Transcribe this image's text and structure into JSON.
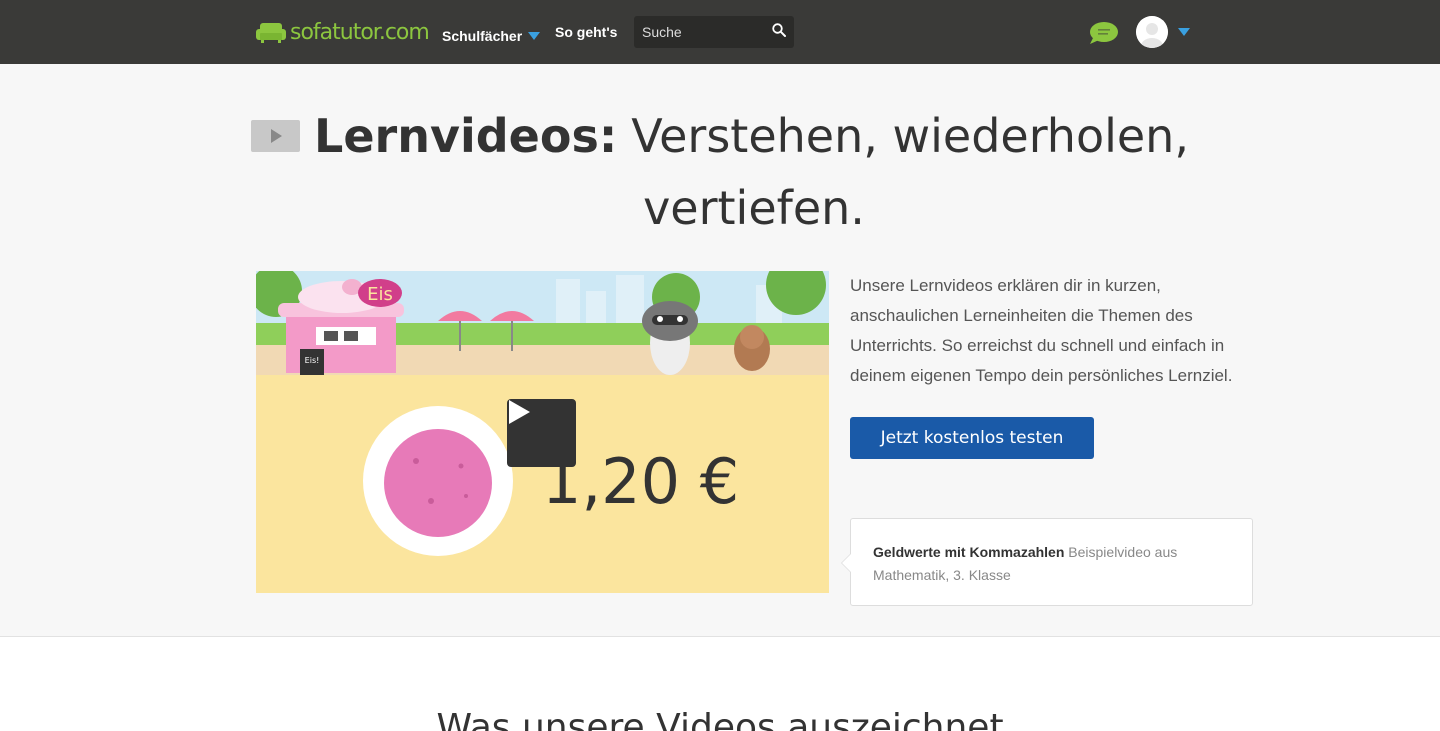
{
  "header": {
    "logo_text": "sofatutor.com",
    "nav": [
      {
        "label": "Schulfächer"
      },
      {
        "label": "So geht's"
      }
    ],
    "search": {
      "placeholder": "Suche",
      "value": ""
    },
    "colors": {
      "bar": "#3a3a38",
      "logo": "#8cc63f",
      "caret": "#3aa0e0"
    },
    "icons": [
      "sofa-logo-icon",
      "search-icon",
      "chat-bubble-icon",
      "user-avatar-icon",
      "chevron-down-icon"
    ]
  },
  "hero": {
    "title_strong": "Lernvideos:",
    "title_rest_line1": "Verstehen, wiederholen,",
    "title_line2": "vertiefen.",
    "description": "Unsere Lernvideos erklären dir in kurzen, anschaulichen Lerneinheiten die Themen des Unterrichts. So erreichst du schnell und einfach in deinem eigenen Tempo dein persönliches Lernziel.",
    "cta_label": "Jetzt kostenlos testen",
    "cta_color": "#1a5aa8"
  },
  "video": {
    "shop_sign": "Eis",
    "board_sign": "Eis!",
    "price": "1,20 €",
    "caption_title": "Geldwerte mit Kommazahlen",
    "caption_meta": "Beispielvideo aus Mathematik, 3. Klasse"
  },
  "section2": {
    "heading": "Was unsere Videos auszeichnet"
  }
}
